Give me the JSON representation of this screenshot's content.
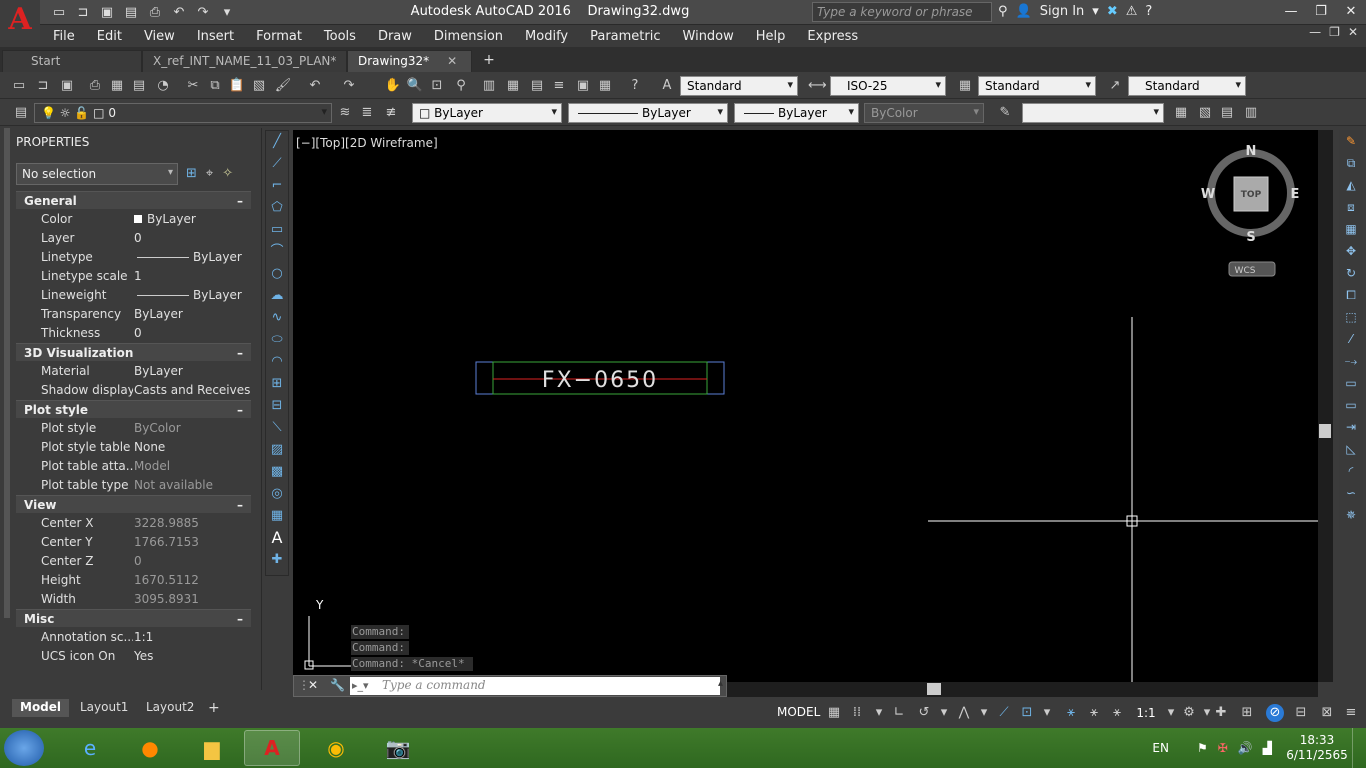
{
  "app": {
    "title": "Autodesk AutoCAD 2016",
    "document": "Drawing32.dwg",
    "search_placeholder": "Type a keyword or phrase",
    "sign_in": "Sign In"
  },
  "menu": [
    "File",
    "Edit",
    "View",
    "Insert",
    "Format",
    "Tools",
    "Draw",
    "Dimension",
    "Modify",
    "Parametric",
    "Window",
    "Help",
    "Express"
  ],
  "tabs": [
    {
      "label": "Start"
    },
    {
      "label": "X_ref_INT_NAME_11_03_PLAN*"
    },
    {
      "label": "Drawing32*"
    }
  ],
  "toolbar": {
    "text_style": "Standard",
    "dim_style": "ISO-25",
    "table_style": "Standard",
    "mleader_style": "Standard",
    "layer": "0",
    "color": "ByLayer",
    "linetype": "ByLayer",
    "lineweight": "ByLayer",
    "plotstyle": "ByColor"
  },
  "properties": {
    "title": "PROPERTIES",
    "selection": "No selection",
    "sections": {
      "general": {
        "title": "General",
        "rows": [
          {
            "k": "Color",
            "v": "ByLayer"
          },
          {
            "k": "Layer",
            "v": "0"
          },
          {
            "k": "Linetype",
            "v": "ByLayer"
          },
          {
            "k": "Linetype scale",
            "v": "1"
          },
          {
            "k": "Lineweight",
            "v": "ByLayer"
          },
          {
            "k": "Transparency",
            "v": "ByLayer"
          },
          {
            "k": "Thickness",
            "v": "0"
          }
        ]
      },
      "viz": {
        "title": "3D Visualization",
        "rows": [
          {
            "k": "Material",
            "v": "ByLayer"
          },
          {
            "k": "Shadow display",
            "v": "Casts and Receives..."
          }
        ]
      },
      "plot": {
        "title": "Plot style",
        "rows": [
          {
            "k": "Plot style",
            "v": "ByColor"
          },
          {
            "k": "Plot style table",
            "v": "None"
          },
          {
            "k": "Plot table atta...",
            "v": "Model"
          },
          {
            "k": "Plot table type",
            "v": "Not available"
          }
        ]
      },
      "view": {
        "title": "View",
        "rows": [
          {
            "k": "Center X",
            "v": "3228.9885"
          },
          {
            "k": "Center Y",
            "v": "1766.7153"
          },
          {
            "k": "Center Z",
            "v": "0"
          },
          {
            "k": "Height",
            "v": "1670.5112"
          },
          {
            "k": "Width",
            "v": "3095.8931"
          }
        ]
      },
      "misc": {
        "title": "Misc",
        "rows": [
          {
            "k": "Annotation sc...",
            "v": "1:1"
          },
          {
            "k": "UCS icon On",
            "v": "Yes"
          }
        ]
      }
    }
  },
  "viewport": {
    "label": "[−][Top][2D Wireframe]",
    "block_text": "FX−0650",
    "viewcube": {
      "n": "N",
      "s": "S",
      "e": "E",
      "w": "W",
      "top": "TOP",
      "wcs": "WCS"
    },
    "ucs_y": "Y"
  },
  "command": {
    "history": [
      "Command:",
      "Command:",
      "Command: *Cancel*"
    ],
    "placeholder": "Type a command"
  },
  "layout_tabs": [
    "Model",
    "Layout1",
    "Layout2"
  ],
  "status": {
    "model": "MODEL",
    "scale": "1:1"
  },
  "taskbar": {
    "lang": "EN",
    "time": "18:33",
    "date": "6/11/2565"
  }
}
